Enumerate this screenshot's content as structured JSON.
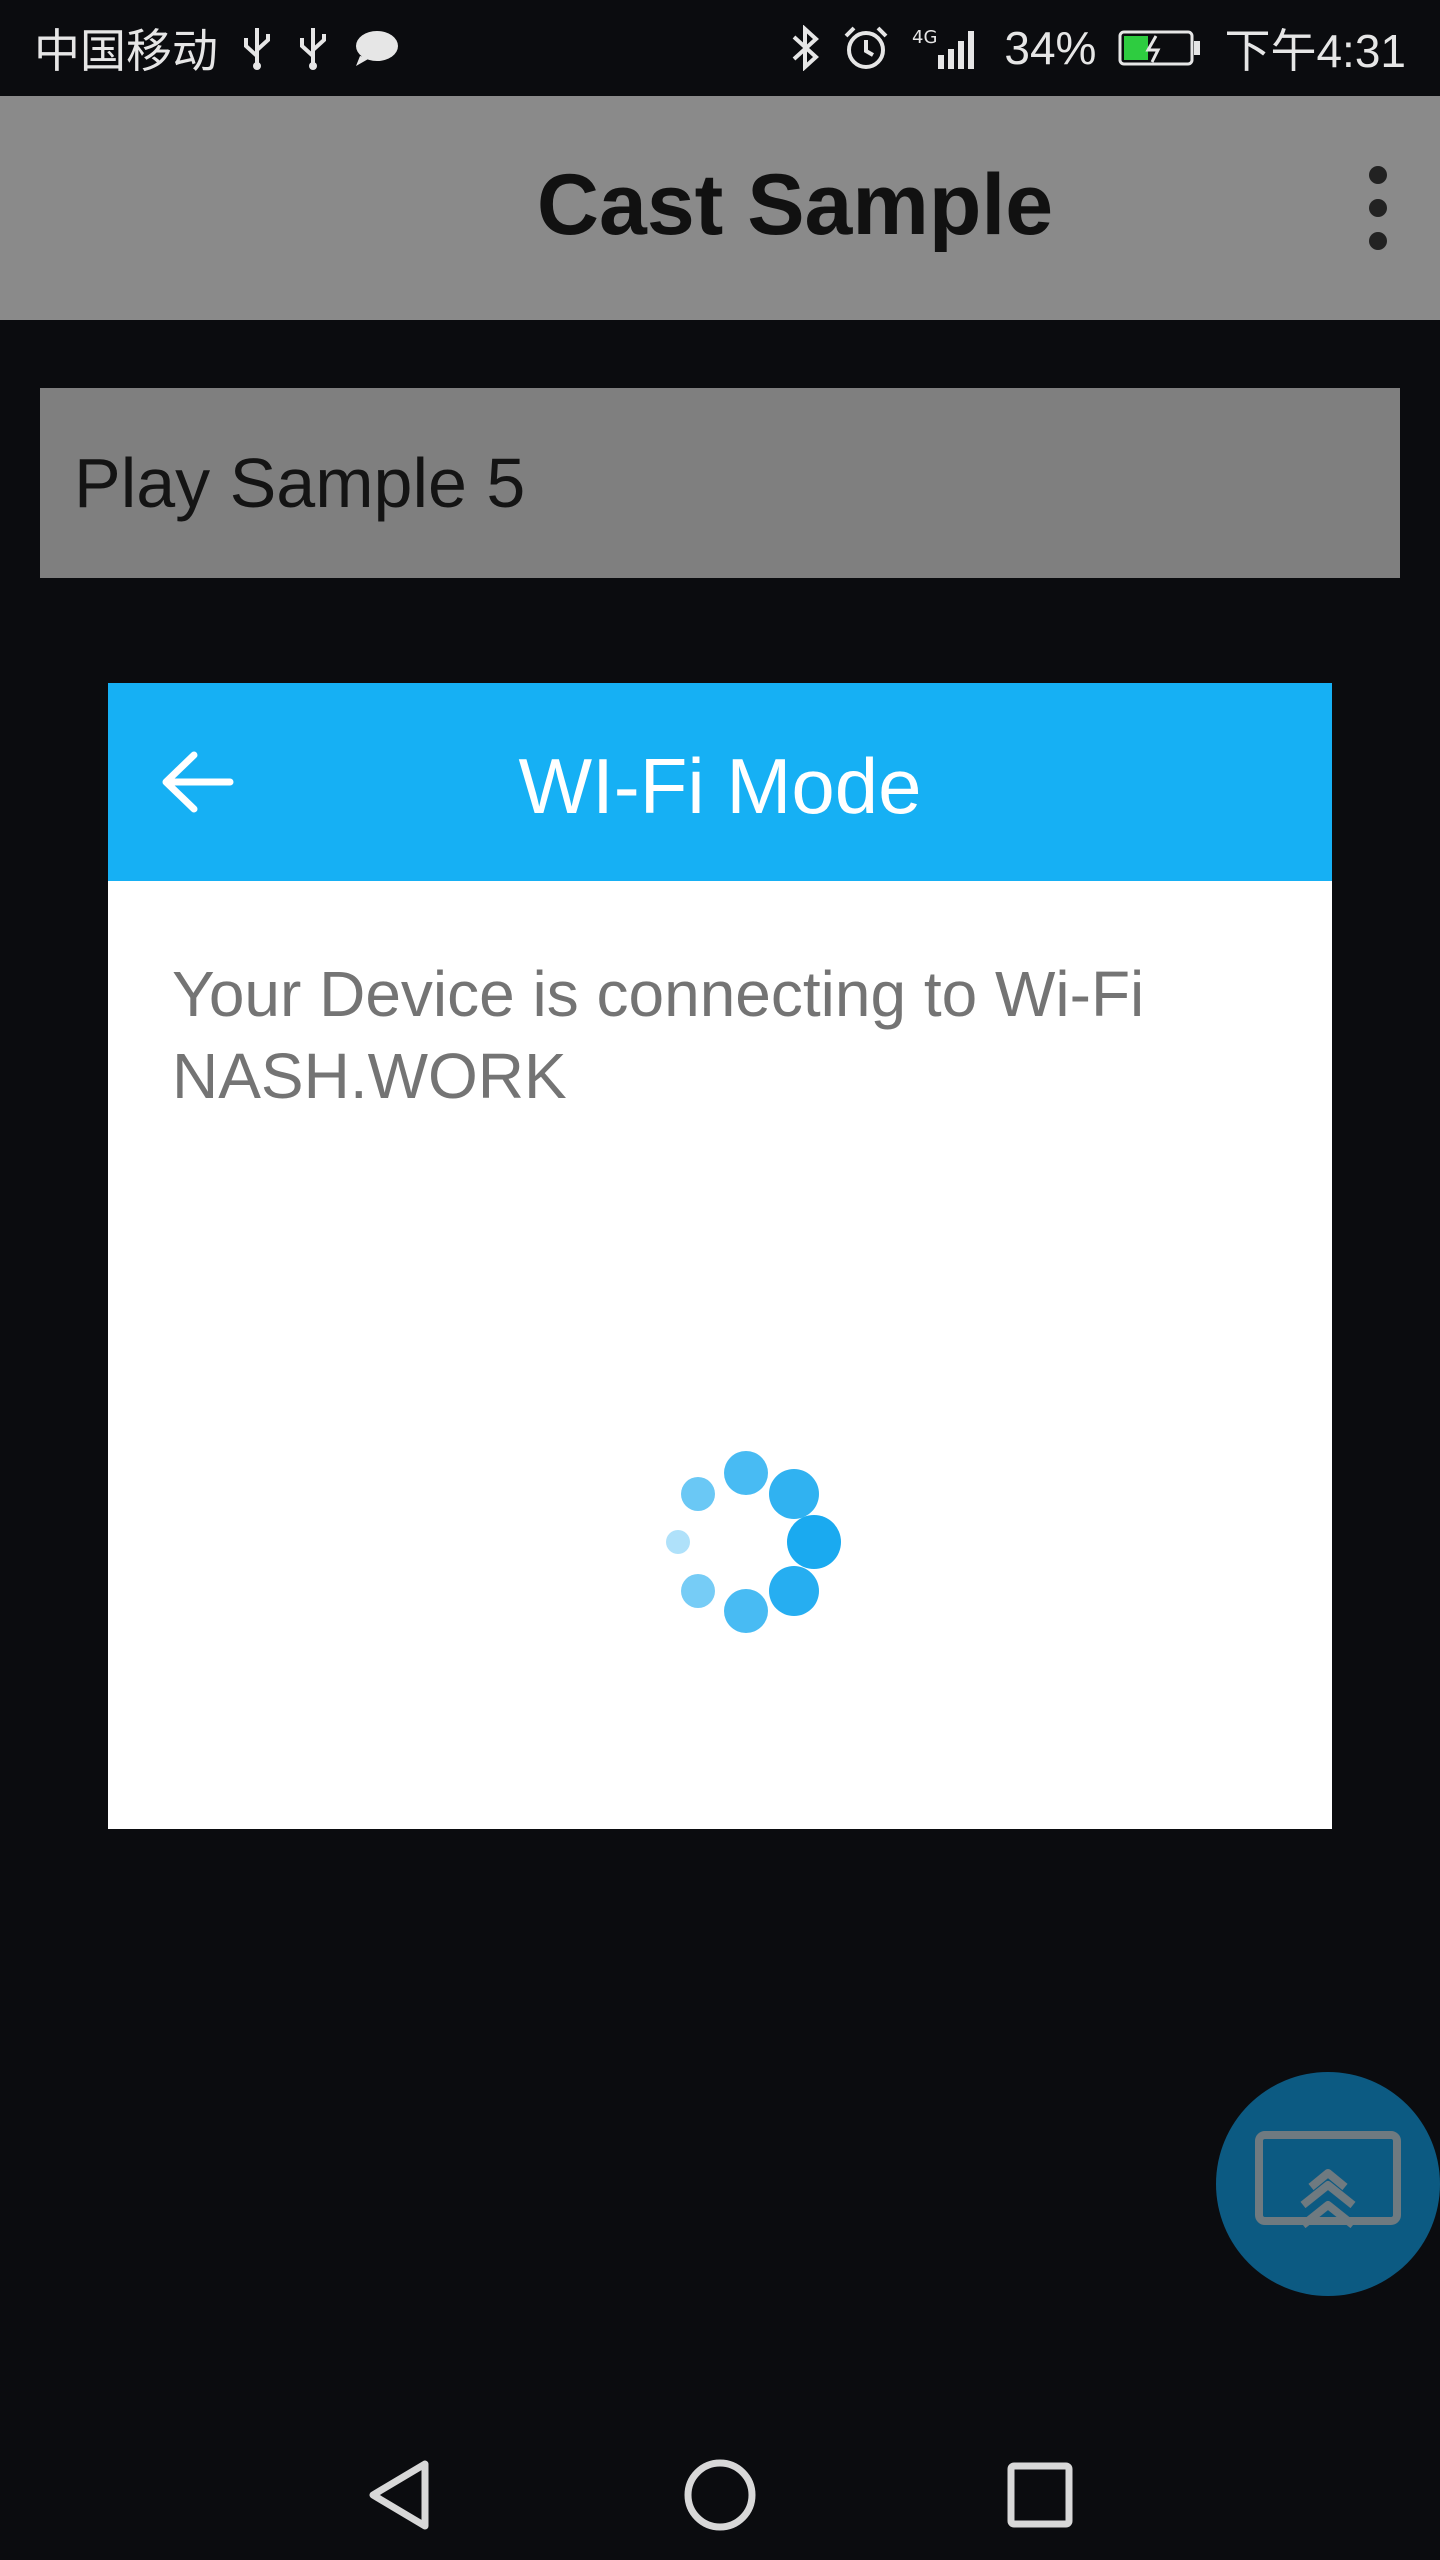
{
  "status_bar": {
    "carrier": "中国移动",
    "battery": "34%",
    "time": "下午4:31",
    "network": "4G",
    "icons": [
      "usb-icon",
      "usb-icon",
      "message-icon",
      "bluetooth-icon",
      "alarm-icon",
      "signal-icon",
      "battery-icon"
    ]
  },
  "app_bar": {
    "title": "Cast Sample",
    "overflow_icon": "more-vert-icon"
  },
  "main": {
    "play_button_label": "Play Sample 5"
  },
  "dialog": {
    "title": "WI-Fi Mode",
    "back_icon": "arrow-left-icon",
    "message_line1": "Your Device is connecting to Wi-Fi",
    "message_line2": "NASH.WORK",
    "header_color": "#16b0f4",
    "spinner_color": "#1aaaf0"
  },
  "fab": {
    "icon": "cast-screen-icon",
    "color": "#0c5a82"
  },
  "nav_bar": {
    "icons": [
      "back-triangle-icon",
      "home-circle-icon",
      "recents-square-icon"
    ]
  }
}
